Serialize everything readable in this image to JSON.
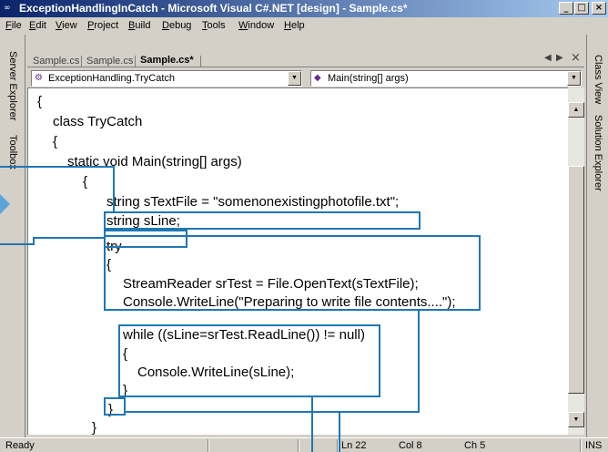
{
  "window": {
    "title": "ExceptionHandlingInCatch - Microsoft Visual C#.NET [design] - Sample.cs*",
    "app_icon": "vs-app-icon",
    "controls": {
      "minimize": "_",
      "maximize": "□",
      "close": "×"
    }
  },
  "menu": {
    "items": [
      {
        "label": "File",
        "key": "F",
        "rest": "ile"
      },
      {
        "label": "Edit",
        "key": "E",
        "rest": "dit"
      },
      {
        "label": "View",
        "key": "V",
        "rest": "iew"
      },
      {
        "label": "Project",
        "key": "P",
        "rest": "roject"
      },
      {
        "label": "Build",
        "key": "B",
        "rest": "uild"
      },
      {
        "label": "Debug",
        "key": "D",
        "rest": "ebug"
      },
      {
        "label": "Tools",
        "key": "T",
        "rest": "ools"
      },
      {
        "label": "Window",
        "key": "W",
        "rest": "indow"
      },
      {
        "label": "Help",
        "key": "H",
        "rest": "elp"
      }
    ]
  },
  "left_panel": {
    "server_explorer": "Server Explorer",
    "toolbox": "Toolbox"
  },
  "right_panel": {
    "class_view": "Class View",
    "solution_explorer": "Solution Explorer"
  },
  "tabs": [
    {
      "label": "Sample.cs",
      "active": false
    },
    {
      "label": "Sample.cs",
      "active": false
    },
    {
      "label": "Sample.cs*",
      "active": true
    }
  ],
  "tab_nav": {
    "prev": "◀",
    "next": "▶",
    "close": "×"
  },
  "combos": {
    "type": {
      "value": "ExceptionHandling.TryCatch",
      "icon": "class-icon"
    },
    "member": {
      "value": "Main(string[] args)",
      "icon": "method-icon"
    }
  },
  "code": {
    "lines": [
      "{",
      "class TryCatch",
      "{",
      "static void Main(string[] args)",
      "{",
      "string sTextFile = \"somenonexistingphotofile.txt\";",
      "string sLine;",
      "",
      "try",
      "{",
      "StreamReader srTest = File.OpenText(sTextFile);",
      "Console.WriteLine(\"Preparing to write file contents....\");",
      "",
      "while ((sLine=srTest.ReadLine()) != null)",
      "{",
      "Console.WriteLine(sLine);",
      "}",
      "}",
      "}"
    ]
  },
  "statusbar": {
    "ready": "Ready",
    "line": "Ln 22",
    "col": "Col 8",
    "ch": "Ch 5",
    "ins": "INS"
  },
  "callout_color": "#1f77b4"
}
